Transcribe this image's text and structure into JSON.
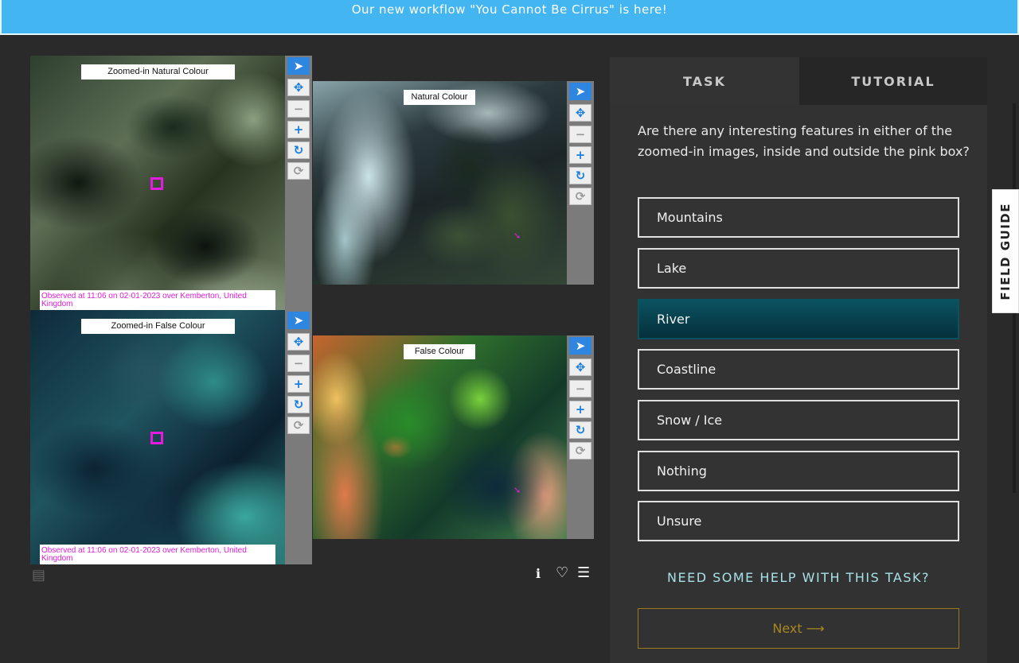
{
  "banner": {
    "text": "Our new workflow \"You Cannot Be Cirrus\" is here!"
  },
  "viewers": {
    "natural_zoom": {
      "label": "Zoomed-in Natural Colour",
      "caption": "Observed at 11:06 on 02-01-2023 over Kemberton, United Kingdom"
    },
    "natural_wide": {
      "label": "Natural Colour"
    },
    "false_zoom": {
      "label": "Zoomed-in False Colour",
      "caption": "Observed at 11:06 on 02-01-2023 over Kemberton, United Kingdom"
    },
    "false_wide": {
      "label": "False Colour"
    }
  },
  "toolbar_icons": {
    "pointer": "➤",
    "move": "✥",
    "zoom_out": "−",
    "zoom_in": "+",
    "rotate": "↻",
    "reset": "⟳"
  },
  "subject_tools": {
    "info": "ℹ",
    "favorite": "♡",
    "collections": "☰",
    "filmstrip": "▤"
  },
  "tabs": {
    "task": "TASK",
    "tutorial": "TUTORIAL"
  },
  "task": {
    "question": "Are there any interesting features in either of the zoomed-in images, inside and outside the pink box?",
    "answers": [
      "Mountains",
      "Lake",
      "River",
      "Coastline",
      "Snow / Ice",
      "Nothing",
      "Unsure"
    ],
    "selected": "River",
    "help": "NEED SOME HELP WITH THIS TASK?",
    "next": "Next ⟶"
  },
  "field_guide": {
    "label": "FIELD GUIDE"
  },
  "colors": {
    "banner": "#43b5f0",
    "accent_blue": "#2e86e0",
    "selected_answer": "#0a5260",
    "pink_marker": "#e41ce0",
    "next_gold": "#a9861f",
    "help_text": "#a7e1e8"
  }
}
